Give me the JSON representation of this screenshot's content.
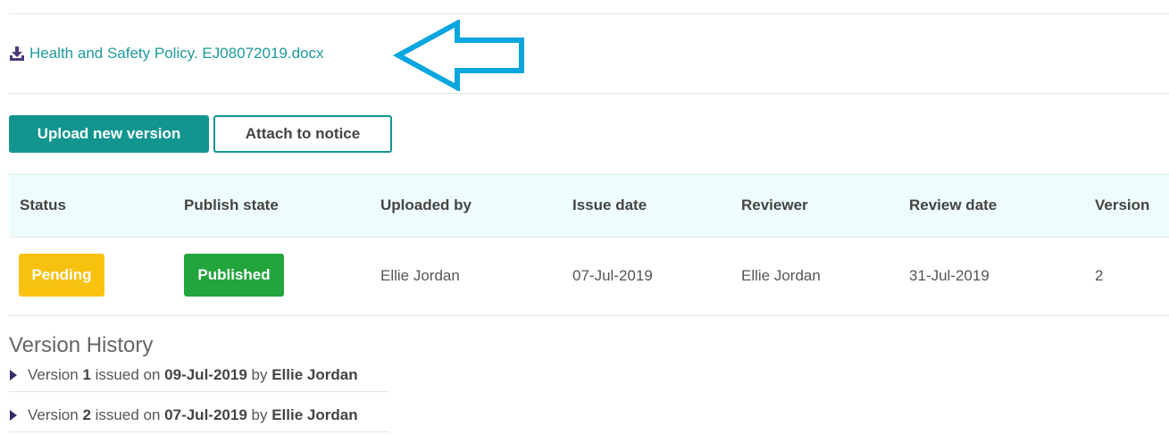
{
  "file": {
    "name": "Health and Safety Policy. EJ08072019.docx",
    "icon": "download-icon"
  },
  "annotation": {
    "icon": "arrow-left-outline-icon",
    "color": "#0aa6e0"
  },
  "actions": {
    "upload_label": "Upload new version",
    "attach_label": "Attach to notice"
  },
  "table": {
    "headers": {
      "status": "Status",
      "publish_state": "Publish state",
      "uploaded_by": "Uploaded by",
      "issue_date": "Issue date",
      "reviewer": "Reviewer",
      "review_date": "Review date",
      "version": "Version"
    },
    "row": {
      "status": "Pending",
      "publish_state": "Published",
      "uploaded_by": "Ellie Jordan",
      "issue_date": "07-Jul-2019",
      "reviewer": "Ellie Jordan",
      "review_date": "31-Jul-2019",
      "version": "2"
    }
  },
  "colors": {
    "accent": "#12958f",
    "link": "#1f9a9a",
    "pending": "#f7c10f",
    "published": "#22a53d",
    "header_bg": "#effcfc"
  },
  "version_history": {
    "title": "Version History",
    "items": [
      {
        "prefix": "Version",
        "version": "1",
        "issued_text": "issued on",
        "date": "09-Jul-2019",
        "by_text": "by",
        "user": "Ellie Jordan"
      },
      {
        "prefix": "Version",
        "version": "2",
        "issued_text": "issued on",
        "date": "07-Jul-2019",
        "by_text": "by",
        "user": "Ellie Jordan"
      }
    ]
  }
}
